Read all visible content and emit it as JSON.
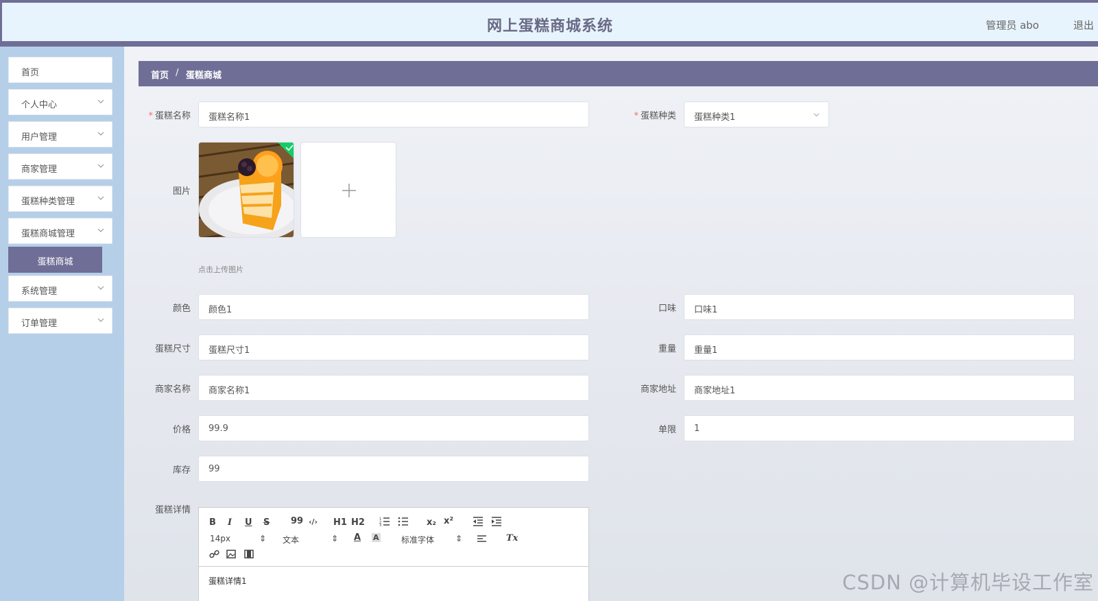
{
  "header": {
    "title": "网上蛋糕商城系统",
    "user": "管理员 abo",
    "logout": "退出"
  },
  "sidebar": {
    "items": [
      {
        "label": "首页"
      },
      {
        "label": "个人中心"
      },
      {
        "label": "用户管理"
      },
      {
        "label": "商家管理"
      },
      {
        "label": "蛋糕种类管理"
      },
      {
        "label": "蛋糕商城管理"
      },
      {
        "label": "系统管理"
      },
      {
        "label": "订单管理"
      }
    ],
    "active_sub": "蛋糕商城"
  },
  "breadcrumb": {
    "home": "首页",
    "sep": "/",
    "current": "蛋糕商城"
  },
  "form": {
    "req_mark": "*",
    "name_label": "蛋糕名称",
    "name_value": "蛋糕名称1",
    "type_label": "蛋糕种类",
    "type_value": "蛋糕种类1",
    "image_label": "图片",
    "upload_tip": "点击上传图片",
    "color_label": "颜色",
    "color_value": "颜色1",
    "taste_label": "口味",
    "taste_value": "口味1",
    "size_label": "蛋糕尺寸",
    "size_value": "蛋糕尺寸1",
    "weight_label": "重量",
    "weight_value": "重量1",
    "shop_label": "商家名称",
    "shop_value": "商家名称1",
    "addr_label": "商家地址",
    "addr_value": "商家地址1",
    "price_label": "价格",
    "price_value": "99.9",
    "limit_label": "单限",
    "limit_value": "1",
    "stock_label": "库存",
    "stock_value": "99",
    "detail_label": "蛋糕详情"
  },
  "editor": {
    "bold": "B",
    "italic": "I",
    "underline": "U",
    "strike": "S",
    "quote": "99",
    "code": "‹/›",
    "h1": "H1",
    "h2": "H2",
    "sub": "x₂",
    "sup": "x²",
    "size": "14px",
    "text": "文本",
    "font": "标准字体",
    "clear": "Tx",
    "content": "蛋糕详情1"
  },
  "watermark": "CSDN @计算机毕设工作室"
}
